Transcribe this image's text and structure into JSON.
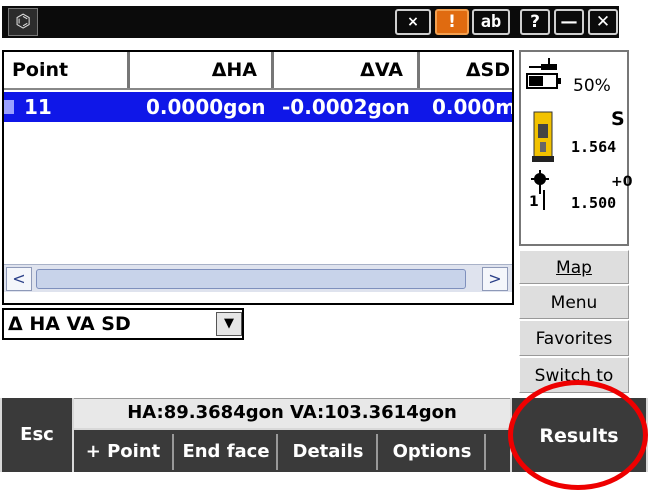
{
  "titlebar": {
    "logo_icon": "trimble-logo-icon",
    "buttons": [
      "×",
      "!",
      "ab",
      "?",
      "—",
      "✕"
    ]
  },
  "table": {
    "headers": [
      "Point",
      "ΔHA",
      "ΔVA",
      "ΔSD"
    ],
    "rows": [
      {
        "point": "11",
        "dha": "0.0000gon",
        "dva": "-0.0002gon",
        "dsd": "0.000m"
      }
    ]
  },
  "status_panel": {
    "battery_pct": "50%",
    "instrument_letter": "S",
    "instrument_height": "1.564",
    "target_offset": "+0",
    "target_number": "1",
    "target_height": "1.500"
  },
  "side_buttons": {
    "map": "Map",
    "menu": "Menu",
    "favorites": "Favorites",
    "switch_to": "Switch to"
  },
  "dropdown": {
    "selected": "Δ HA VA SD"
  },
  "bottom": {
    "esc": "Esc",
    "status_line": "HA:89.3684gon  VA:103.3614gon",
    "softkeys": [
      "+ Point",
      "End face",
      "Details",
      "Options"
    ],
    "results": "Results"
  },
  "colors": {
    "selection": "#0f17e8",
    "highlight_circle": "#ee0000",
    "softkey_bg": "#3a3a3a"
  }
}
